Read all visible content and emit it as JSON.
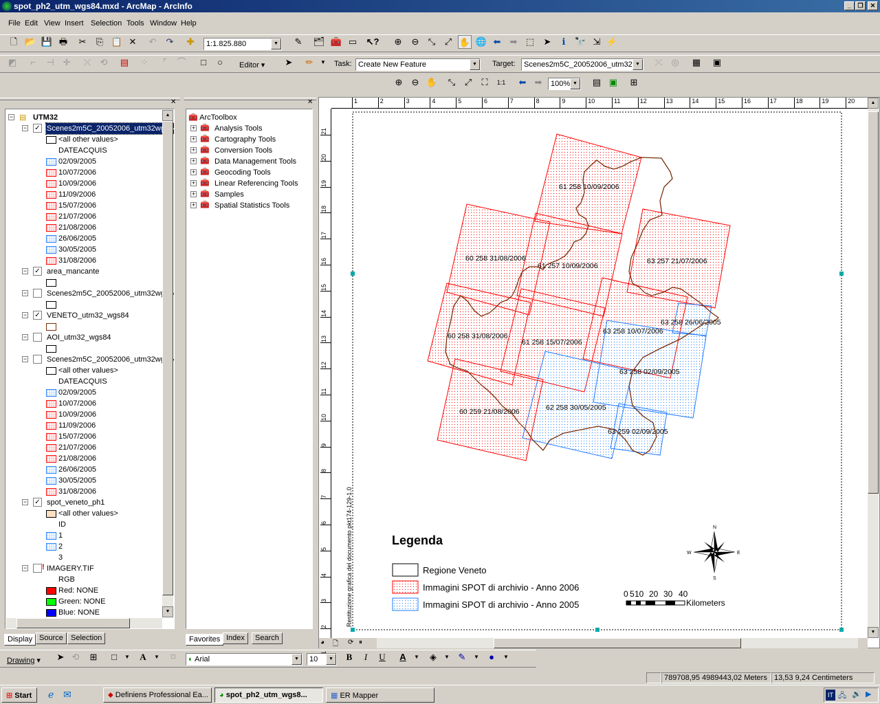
{
  "window": {
    "title": "spot_ph2_utm_wgs84.mxd - ArcMap - ArcInfo"
  },
  "menu": [
    "File",
    "Edit",
    "View",
    "Insert",
    "Selection",
    "Tools",
    "Window",
    "Help"
  ],
  "toolbar": {
    "scale": "1:1.825.880",
    "editor_label": "Editor",
    "task_label": "Task:",
    "task_value": "Create New Feature",
    "target_label": "Target:",
    "target_value": "Scenes2m5C_20052006_utm32wgs84",
    "zoom_value": "100%"
  },
  "toc": {
    "items": [
      {
        "kind": "group",
        "label": "UTM32"
      },
      {
        "kind": "layer",
        "label": "Scenes2m5C_20052006_utm32wgs84",
        "checked": true,
        "selected": true
      },
      {
        "kind": "sym",
        "sw": "white",
        "label": "<all other values>"
      },
      {
        "kind": "head",
        "label": "DATEACQUIS"
      },
      {
        "kind": "sym",
        "sw": "blue",
        "label": "02/09/2005"
      },
      {
        "kind": "sym",
        "sw": "red",
        "label": "10/07/2006"
      },
      {
        "kind": "sym",
        "sw": "red",
        "label": "10/09/2006"
      },
      {
        "kind": "sym",
        "sw": "red",
        "label": "11/09/2006"
      },
      {
        "kind": "sym",
        "sw": "red",
        "label": "15/07/2006"
      },
      {
        "kind": "sym",
        "sw": "red",
        "label": "21/07/2006"
      },
      {
        "kind": "sym",
        "sw": "red",
        "label": "21/08/2006"
      },
      {
        "kind": "sym",
        "sw": "blue",
        "label": "26/06/2005"
      },
      {
        "kind": "sym",
        "sw": "blue",
        "label": "30/05/2005"
      },
      {
        "kind": "sym",
        "sw": "red",
        "label": "31/08/2006"
      },
      {
        "kind": "layer",
        "label": "area_mancante",
        "checked": true
      },
      {
        "kind": "sym",
        "sw": "white",
        "label": ""
      },
      {
        "kind": "layer",
        "label": "Scenes2m5C_20052006_utm32wgs84",
        "checked": false
      },
      {
        "kind": "sym",
        "sw": "white",
        "label": ""
      },
      {
        "kind": "layer",
        "label": "VENETO_utm32_wgs84",
        "checked": true
      },
      {
        "kind": "sym",
        "sw": "brown",
        "label": ""
      },
      {
        "kind": "layer",
        "label": "AOI_utm32_wgs84",
        "checked": false
      },
      {
        "kind": "sym",
        "sw": "white",
        "label": ""
      },
      {
        "kind": "layer",
        "label": "Scenes2m5C_20052006_utm32wgs84",
        "checked": false
      },
      {
        "kind": "sym",
        "sw": "white",
        "label": "<all other values>"
      },
      {
        "kind": "head",
        "label": "DATEACQUIS"
      },
      {
        "kind": "sym",
        "sw": "blue",
        "label": "02/09/2005"
      },
      {
        "kind": "sym",
        "sw": "red",
        "label": "10/07/2006"
      },
      {
        "kind": "sym",
        "sw": "red",
        "label": "10/09/2006"
      },
      {
        "kind": "sym",
        "sw": "red",
        "label": "11/09/2006"
      },
      {
        "kind": "sym",
        "sw": "red",
        "label": "15/07/2006"
      },
      {
        "kind": "sym",
        "sw": "red",
        "label": "21/07/2006"
      },
      {
        "kind": "sym",
        "sw": "red",
        "label": "21/08/2006"
      },
      {
        "kind": "sym",
        "sw": "blue",
        "label": "26/06/2005"
      },
      {
        "kind": "sym",
        "sw": "blue",
        "label": "30/05/2005"
      },
      {
        "kind": "sym",
        "sw": "red",
        "label": "31/08/2006"
      },
      {
        "kind": "layer",
        "label": "spot_veneto_ph1",
        "checked": true
      },
      {
        "kind": "sym",
        "sw": "peach",
        "label": "<all other values>"
      },
      {
        "kind": "head",
        "label": "ID"
      },
      {
        "kind": "sym",
        "sw": "blue",
        "label": "1"
      },
      {
        "kind": "sym",
        "sw": "blue",
        "label": "2"
      },
      {
        "kind": "head",
        "label": "3"
      },
      {
        "kind": "layer",
        "label": "IMAGERY.TIF",
        "checked": false,
        "warn": true
      },
      {
        "kind": "head",
        "label": "RGB"
      },
      {
        "kind": "sym",
        "sw": "#ff0000",
        "label": "Red:   NONE"
      },
      {
        "kind": "sym",
        "sw": "#00ff00",
        "label": "Green: NONE"
      },
      {
        "kind": "sym",
        "sw": "#0000ff",
        "label": "Blue:   NONE"
      }
    ],
    "tabs": [
      "Display",
      "Source",
      "Selection"
    ]
  },
  "toolbox": {
    "root": "ArcToolbox",
    "items": [
      "Analysis Tools",
      "Cartography Tools",
      "Conversion Tools",
      "Data Management Tools",
      "Geocoding Tools",
      "Linear Referencing Tools",
      "Samples",
      "Spatial Statistics Tools"
    ],
    "tabs": [
      "Favorites",
      "Index",
      "Search"
    ]
  },
  "map": {
    "footprints": [
      {
        "label": "61 258 10/09/2006",
        "year": "2006"
      },
      {
        "label": "60 258 31/08/2006",
        "year": "2006"
      },
      {
        "label": "61 257 10/09/2006",
        "year": "2006"
      },
      {
        "label": "63 257 21/07/2006",
        "year": "2006"
      },
      {
        "label": "63 258 26/06/2005",
        "year": "2005"
      },
      {
        "label": "63 258 10/07/2006",
        "year": "2006"
      },
      {
        "label": "60 258 31/08/2006",
        "year": "2006"
      },
      {
        "label": "61 258 15/07/2006",
        "year": "2006"
      },
      {
        "label": "63 258 02/09/2005",
        "year": "2005"
      },
      {
        "label": "62 258 30/05/2005",
        "year": "2005"
      },
      {
        "label": "60 259 21/08/2006",
        "year": "2006"
      },
      {
        "label": "63 259 02/09/2005",
        "year": "2005"
      }
    ],
    "legend": {
      "title": "Legenda",
      "items": [
        "Regione Veneto",
        "Immagini SPOT di archivio - Anno 2006",
        "Immagini SPOT di archivio - Anno 2005"
      ]
    },
    "scalebar": {
      "ticks": [
        "0",
        "5",
        "10",
        "20",
        "30",
        "40"
      ],
      "unit": "Kilometers"
    },
    "north": {
      "n": "N",
      "s": "S",
      "e": "E",
      "w": "W"
    },
    "side_text": "Restituzione grafica del documento pkt174-129-1.0",
    "h_ruler": [
      "1",
      "2",
      "3",
      "4",
      "5",
      "6",
      "7",
      "8",
      "9",
      "10",
      "11",
      "12",
      "13",
      "14",
      "15",
      "16",
      "17",
      "18",
      "19",
      "20"
    ],
    "v_ruler": [
      "21",
      "20",
      "19",
      "18",
      "17",
      "16",
      "15",
      "14",
      "13",
      "12",
      "11",
      "10",
      "9",
      "8",
      "7",
      "6",
      "5",
      "4",
      "3",
      "2",
      "1"
    ],
    "colors": {
      "red": "#ff0000",
      "blue": "#1e7cff",
      "boundary": "#7a2e0a"
    }
  },
  "drawing": {
    "label": "Drawing",
    "font": "Arial",
    "size": "10"
  },
  "status": {
    "coords": "789708,95  4989443,02 Meters",
    "page": "13,53  9,24 Centimeters"
  },
  "taskbar": {
    "start": "Start",
    "tasks": [
      "Definiens Professional Ea...",
      "spot_ph2_utm_wgs8...",
      "ER Mapper"
    ]
  }
}
